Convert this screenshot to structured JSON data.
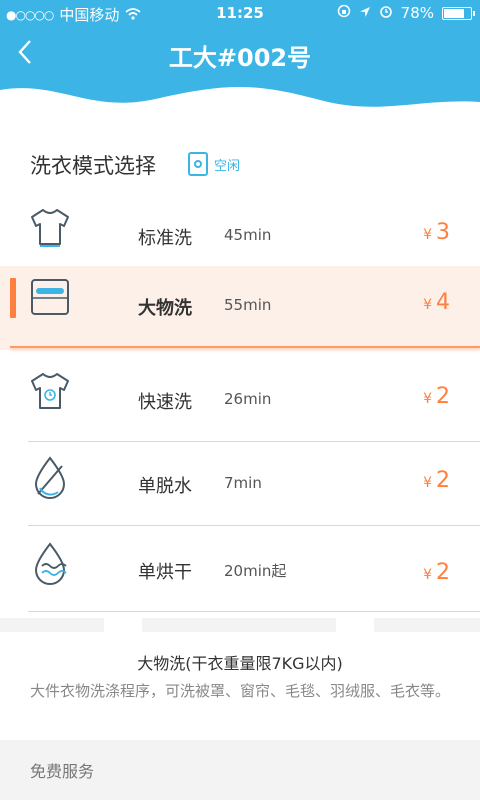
{
  "status_bar": {
    "carrier": "中国移动",
    "time": "11:25",
    "battery": "78%",
    "battery_level": 0.78
  },
  "header": {
    "title": "工大#002号",
    "back_icon": "chevron-left-icon"
  },
  "section": {
    "title": "洗衣模式选择",
    "machine_status": "空闲"
  },
  "modes": [
    {
      "name": "标准洗",
      "duration": "45min",
      "currency": "¥",
      "price": "3",
      "icon": "tshirt-icon",
      "selected": false
    },
    {
      "name": "大物洗",
      "duration": "55min",
      "currency": "¥",
      "price": "4",
      "icon": "bulky-load-icon",
      "selected": true
    },
    {
      "name": "快速洗",
      "duration": "26min",
      "currency": "¥",
      "price": "2",
      "icon": "tshirt-clock-icon",
      "selected": false
    },
    {
      "name": "单脱水",
      "duration": "7min",
      "currency": "¥",
      "price": "2",
      "icon": "water-drop-slash-icon",
      "selected": false
    },
    {
      "name": "单烘干",
      "duration": "20min起",
      "currency": "¥",
      "price": "2",
      "icon": "water-drop-wave-icon",
      "selected": false
    }
  ],
  "description": {
    "title": "大物洗(干衣重量限7KG以内)",
    "text": "大件衣物洗涤程序，可洗被罩、窗帘、毛毯、羽绒服、毛衣等。"
  },
  "free_service": {
    "label": "免费服务"
  },
  "colors": {
    "primary": "#3cb5e6",
    "accent": "#ff7f3f",
    "icon_stroke": "#4a5a66"
  }
}
